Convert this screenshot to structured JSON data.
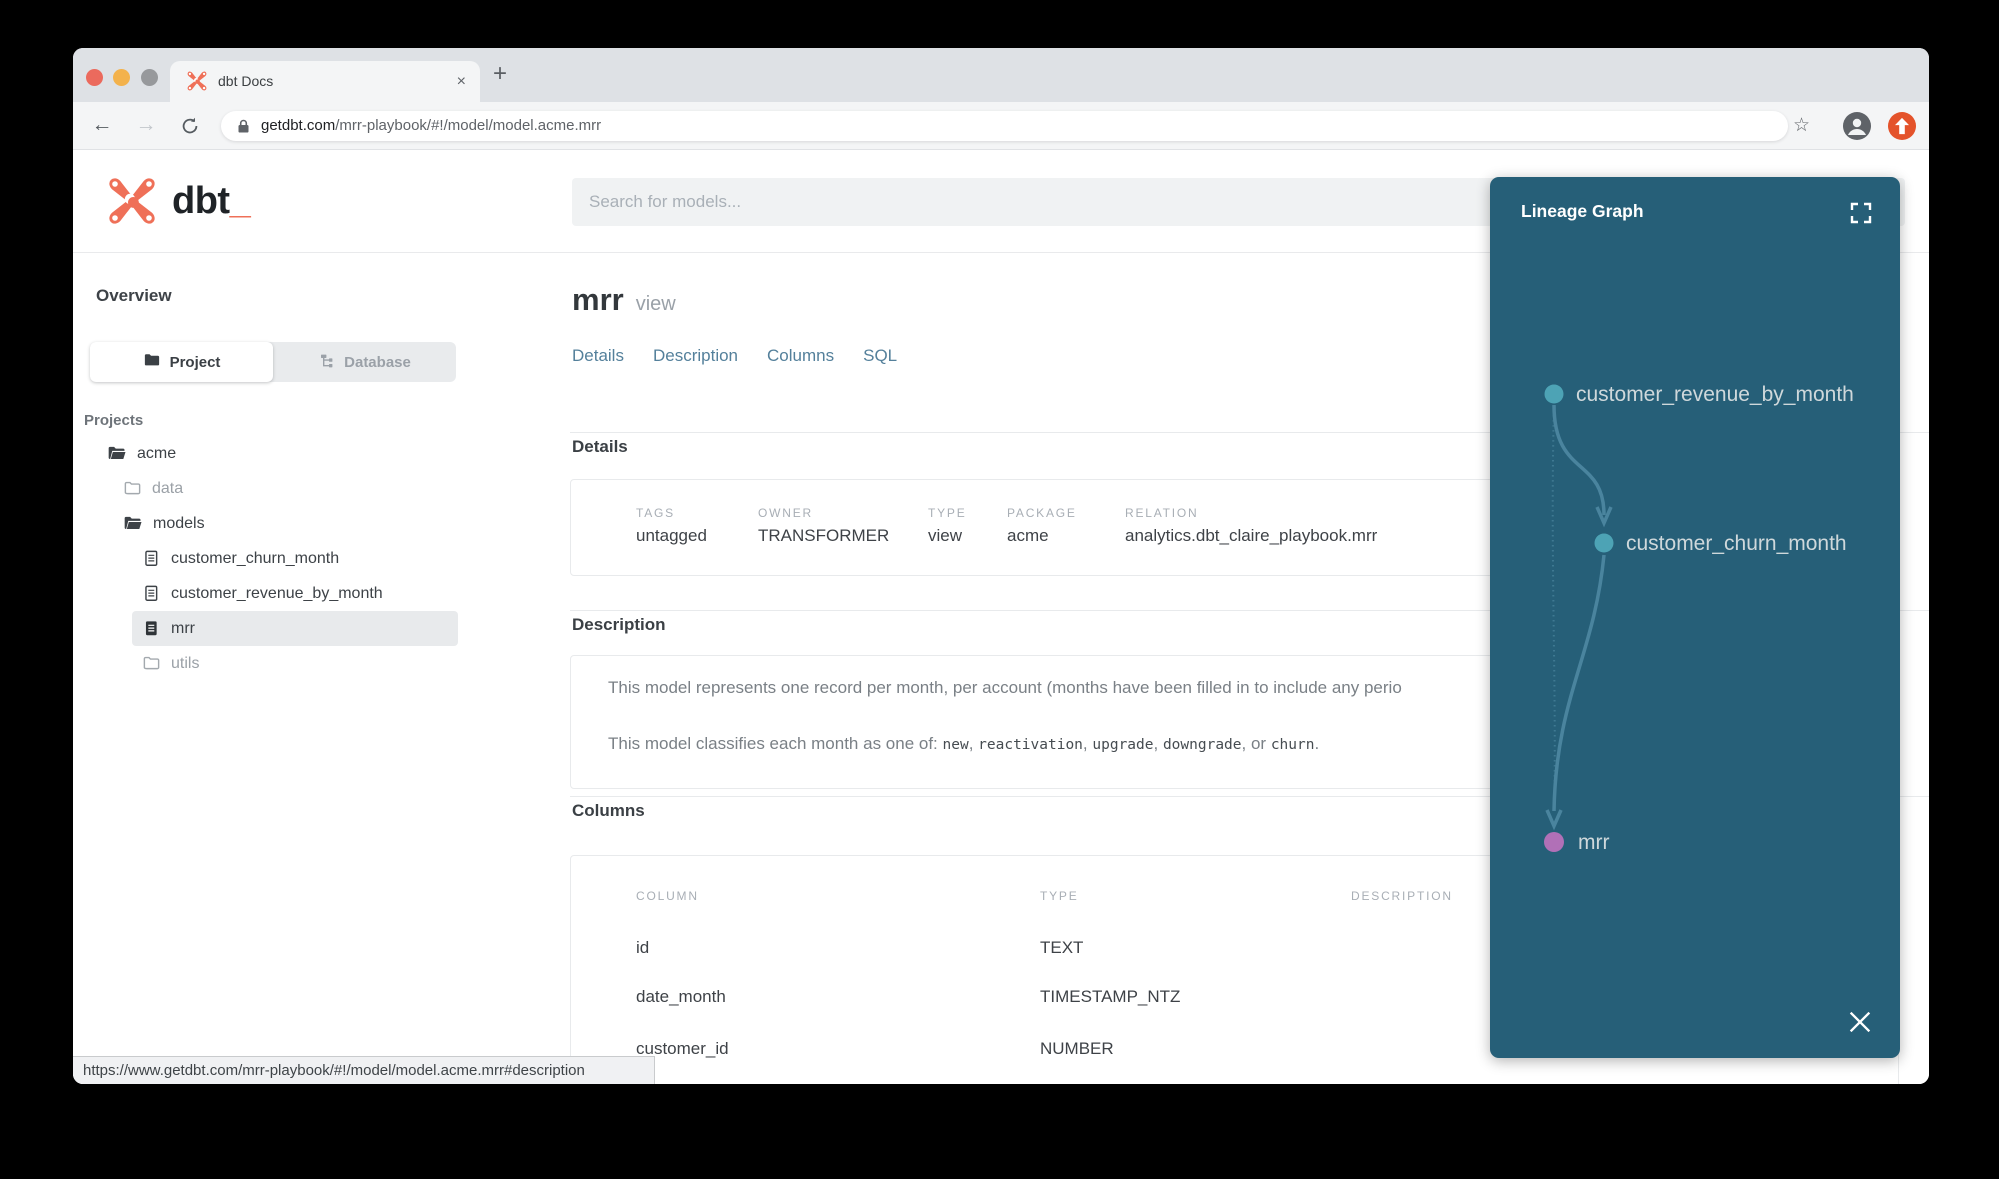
{
  "colors": {
    "dbt_orange": "#ef7058",
    "panel_teal": "#265f78",
    "node_teal": "#4da3b5",
    "node_purple": "#b170b7",
    "edge_blue": "#4e89a3",
    "link_blue": "#54809b"
  },
  "browser": {
    "tab_title": "dbt Docs",
    "tab_close": "×",
    "new_tab": "+",
    "back": "←",
    "forward": "→",
    "url_host": "getdbt.com",
    "url_path": "/mrr-playbook/#!/model/model.acme.mrr",
    "star": "☆",
    "status_url": "https://www.getdbt.com/mrr-playbook/#!/model/model.acme.mrr#description"
  },
  "header": {
    "logo_text": "dbt",
    "logo_underscore": "_",
    "search_placeholder": "Search for models..."
  },
  "sidebar": {
    "overview_label": "Overview",
    "toggle": {
      "project": "Project",
      "database": "Database"
    },
    "projects_label": "Projects",
    "tree": [
      {
        "label": "acme"
      },
      {
        "label": "data"
      },
      {
        "label": "models"
      },
      {
        "label": "customer_churn_month"
      },
      {
        "label": "customer_revenue_by_month"
      },
      {
        "label": "mrr"
      },
      {
        "label": "utils"
      }
    ]
  },
  "main": {
    "title": "mrr",
    "title_badge": "view",
    "tabs": [
      "Details",
      "Description",
      "Columns",
      "SQL"
    ],
    "details": {
      "heading": "Details",
      "fields": [
        {
          "label": "TAGS",
          "value": "untagged"
        },
        {
          "label": "OWNER",
          "value": "TRANSFORMER"
        },
        {
          "label": "TYPE",
          "value": "view"
        },
        {
          "label": "PACKAGE",
          "value": "acme"
        },
        {
          "label": "RELATION",
          "value": "analytics.dbt_claire_playbook.mrr"
        }
      ]
    },
    "description": {
      "heading": "Description",
      "para1": "This model represents one record per month, per account (months have been filled in to include any perio",
      "para2_segments": [
        {
          "text": "This model classifies each month as one of: "
        },
        {
          "text": "new"
        },
        {
          "text": ", "
        },
        {
          "text": "reactivation"
        },
        {
          "text": ", "
        },
        {
          "text": "upgrade"
        },
        {
          "text": ", "
        },
        {
          "text": "downgrade"
        },
        {
          "text": ", or "
        },
        {
          "text": "churn"
        },
        {
          "text": "."
        }
      ]
    },
    "columns": {
      "heading": "Columns",
      "headers": [
        "COLUMN",
        "TYPE",
        "DESCRIPTION"
      ],
      "rows": [
        {
          "column": "id",
          "type": "TEXT",
          "description": ""
        },
        {
          "column": "date_month",
          "type": "TIMESTAMP_NTZ",
          "description": ""
        },
        {
          "column": "customer_id",
          "type": "NUMBER",
          "description": ""
        }
      ]
    }
  },
  "lineage": {
    "title": "Lineage Graph",
    "nodes": [
      {
        "id": "customer_revenue_by_month",
        "color": "#4da3b5"
      },
      {
        "id": "customer_churn_month",
        "color": "#4da3b5"
      },
      {
        "id": "mrr",
        "color": "#b170b7"
      }
    ],
    "edges": [
      {
        "from": "customer_revenue_by_month",
        "to": "customer_churn_month"
      },
      {
        "from": "customer_revenue_by_month",
        "to": "mrr"
      },
      {
        "from": "customer_churn_month",
        "to": "mrr"
      }
    ]
  }
}
